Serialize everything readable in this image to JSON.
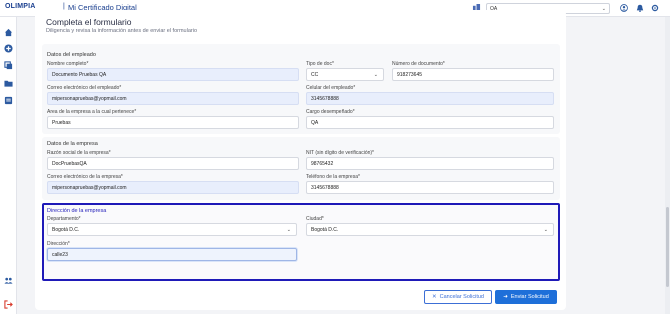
{
  "header": {
    "brand": "OLIMPIA",
    "separator": "|",
    "app_title": "Mi Certificado Digital",
    "company_select_value": "QA"
  },
  "form": {
    "title": "Completa el formulario",
    "subtitle": "Diligencia y revisa la información antes de enviar el formulario",
    "employee": {
      "section_title": "Datos del empleado",
      "full_name_label": "Nombre completo*",
      "full_name_value": "Documento Pruebas QA",
      "doc_type_label": "Tipo de doc*",
      "doc_type_value": "CC",
      "doc_number_label": "Número de documento*",
      "doc_number_value": "918273645",
      "email_label": "Correo electrónico del empleado*",
      "email_value": "mipersonapruebas@yopmail.com",
      "phone_label": "Celular del empleado*",
      "phone_value": "3145678888",
      "area_label": "Area de la empresa a la cual pertenece*",
      "area_value": "Pruebas",
      "position_label": "Cargo desempeñado*",
      "position_value": "QA"
    },
    "company": {
      "section_title": "Datos de la empresa",
      "legal_name_label": "Razón social de la empresa*",
      "legal_name_value": "DocPruebasQA",
      "nit_label": "NIT (sin dígito de verificación)*",
      "nit_value": "98765432",
      "email_label": "Correo electrónico de la empresa*",
      "email_value": "mipersonapruebas@yopmail.com",
      "phone_label": "Teléfono de la empresa*",
      "phone_value": "3145678888"
    },
    "address": {
      "section_title": "Dirección de la empresa",
      "department_label": "Departamento*",
      "department_value": "Bogotá D.C.",
      "city_label": "Ciudad*",
      "city_value": "Bogotá D.C.",
      "address_label": "Dirección*",
      "address_value": "calle23"
    },
    "actions": {
      "cancel_label": "Cancelar Solicitud",
      "send_label": "Enviar Solicitud"
    }
  },
  "colors": {
    "brand": "#1a3f8f",
    "accent": "#1e6fd9",
    "highlight_border": "#1f1ab8",
    "readonly_field": "#e8eefc"
  },
  "icons": {
    "topbar": [
      "company-icon",
      "user-circle-icon",
      "bell-icon",
      "settings-icon"
    ],
    "sidebar": [
      "home-icon",
      "add-circle-icon",
      "copy-icon",
      "folder-icon",
      "news-icon",
      "users-icon",
      "logout-icon"
    ]
  }
}
